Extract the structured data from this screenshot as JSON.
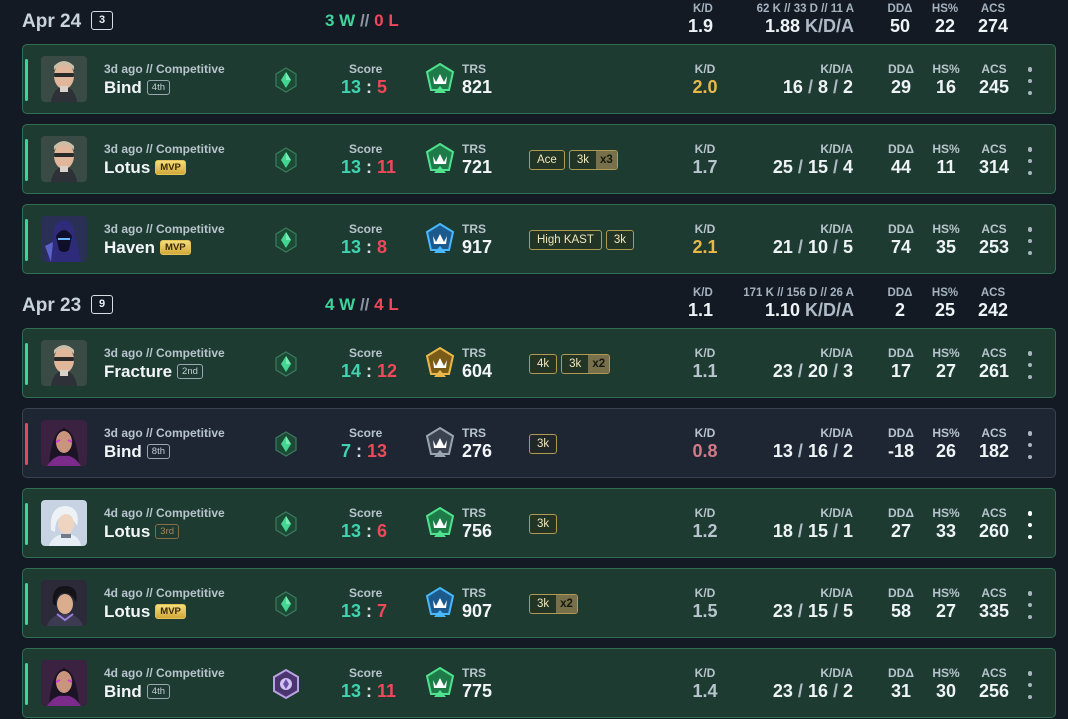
{
  "labels": {
    "score": "Score",
    "trs": "TRS",
    "kd": "K/D",
    "kda": "K/D/A",
    "dd": "DDΔ",
    "hs": "HS%",
    "acs": "ACS",
    "kda_unit": "K/D/A"
  },
  "colors": {
    "win": "#3ed49a",
    "loss": "#f0485a",
    "gold": "#e9b84a",
    "pink": "#d47a87",
    "gray": "#b7c4cd"
  },
  "days": [
    {
      "date": "Apr 24",
      "count": "3",
      "wins": "3 W",
      "sep": "//",
      "losses": "0 L",
      "kd": "1.9",
      "kda_detail": "62 K // 33 D // 11 A",
      "kda": "1.88",
      "dd": "50",
      "hs": "22",
      "acs": "274"
    },
    {
      "date": "Apr 23",
      "count": "9",
      "wins": "4 W",
      "sep": "//",
      "losses": "4 L",
      "kd": "1.1",
      "kda_detail": "171 K // 156 D // 26 A",
      "kda": "1.10",
      "dd": "2",
      "hs": "25",
      "acs": "242"
    }
  ],
  "matches": [
    {
      "ago": "3d ago // Competitive",
      "map": "Bind",
      "place": "4th",
      "place_style": "plain",
      "agent": "chamber",
      "rank": "emerald",
      "score_a": "13",
      "score_b": "5",
      "trs_color": "green",
      "trs": "821",
      "badges": [],
      "kd": "2.0",
      "kd_color": "gold",
      "k": "16",
      "d": "8",
      "a": "2",
      "dd": "29",
      "hs": "16",
      "acs": "245",
      "result": "win",
      "more_icon": "gray"
    },
    {
      "ago": "3d ago // Competitive",
      "map": "Lotus",
      "place": "MVP",
      "place_style": "mvp",
      "agent": "chamber",
      "rank": "emerald",
      "score_a": "13",
      "score_b": "11",
      "trs_color": "green",
      "trs": "721",
      "badges": [
        {
          "t": "Ace"
        },
        {
          "t": "3k",
          "x": "x3"
        }
      ],
      "kd": "1.7",
      "kd_color": "gray",
      "k": "25",
      "d": "15",
      "a": "4",
      "dd": "44",
      "hs": "11",
      "acs": "314",
      "result": "win",
      "more_icon": "gray"
    },
    {
      "ago": "3d ago // Competitive",
      "map": "Haven",
      "place": "MVP",
      "place_style": "mvp",
      "agent": "omen",
      "rank": "emerald",
      "score_a": "13",
      "score_b": "8",
      "trs_color": "blue",
      "trs": "917",
      "badges": [
        {
          "t": "High KAST"
        },
        {
          "t": "3k"
        }
      ],
      "kd": "2.1",
      "kd_color": "gold",
      "k": "21",
      "d": "10",
      "a": "5",
      "dd": "74",
      "hs": "35",
      "acs": "253",
      "result": "win",
      "more_icon": "gray"
    },
    {
      "ago": "3d ago // Competitive",
      "map": "Fracture",
      "place": "2nd",
      "place_style": "plain",
      "agent": "chamber",
      "rank": "emerald",
      "score_a": "14",
      "score_b": "12",
      "trs_color": "gold",
      "trs": "604",
      "badges": [
        {
          "t": "4k"
        },
        {
          "t": "3k",
          "x": "x2"
        }
      ],
      "kd": "1.1",
      "kd_color": "gray",
      "k": "23",
      "d": "20",
      "a": "3",
      "dd": "17",
      "hs": "27",
      "acs": "261",
      "result": "win",
      "more_icon": "gray"
    },
    {
      "ago": "3d ago // Competitive",
      "map": "Bind",
      "place": "8th",
      "place_style": "plain",
      "agent": "reyna",
      "rank": "emerald",
      "score_a": "7",
      "score_b": "13",
      "trs_color": "gray",
      "trs": "276",
      "badges": [
        {
          "t": "3k"
        }
      ],
      "kd": "0.8",
      "kd_color": "pink",
      "k": "13",
      "d": "16",
      "a": "2",
      "dd": "-18",
      "hs": "26",
      "acs": "182",
      "result": "loss",
      "more_icon": "gray"
    },
    {
      "ago": "4d ago // Competitive",
      "map": "Lotus",
      "place": "3rd",
      "place_style": "third",
      "agent": "jett",
      "rank": "emerald",
      "score_a": "13",
      "score_b": "6",
      "trs_color": "green",
      "trs": "756",
      "badges": [
        {
          "t": "3k"
        }
      ],
      "kd": "1.2",
      "kd_color": "gray",
      "k": "18",
      "d": "15",
      "a": "1",
      "dd": "27",
      "hs": "33",
      "acs": "260",
      "result": "win",
      "more_icon": "white"
    },
    {
      "ago": "4d ago // Competitive",
      "map": "Lotus",
      "place": "MVP",
      "place_style": "mvp",
      "agent": "iso",
      "rank": "emerald",
      "score_a": "13",
      "score_b": "7",
      "trs_color": "blue",
      "trs": "907",
      "badges": [
        {
          "t": "3k",
          "x": "x2"
        }
      ],
      "kd": "1.5",
      "kd_color": "gray",
      "k": "23",
      "d": "15",
      "a": "5",
      "dd": "58",
      "hs": "27",
      "acs": "335",
      "result": "win",
      "more_icon": "gray"
    },
    {
      "ago": "4d ago // Competitive",
      "map": "Bind",
      "place": "4th",
      "place_style": "plain",
      "agent": "reyna",
      "rank": "ascendant",
      "score_a": "13",
      "score_b": "11",
      "trs_color": "green",
      "trs": "775",
      "badges": [],
      "kd": "1.4",
      "kd_color": "gray",
      "k": "23",
      "d": "16",
      "a": "2",
      "dd": "31",
      "hs": "30",
      "acs": "256",
      "result": "win",
      "more_icon": "gray"
    }
  ]
}
